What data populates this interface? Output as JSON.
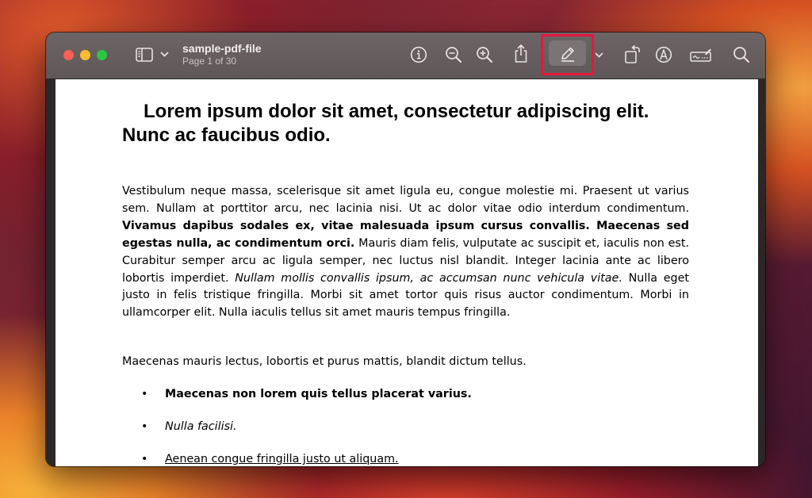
{
  "window": {
    "document_name": "sample-pdf-file",
    "page_indicator": "Page 1 of 30"
  },
  "toolbar": {
    "icons": [
      "sidebar-icon",
      "chevron-down-icon",
      "info-icon",
      "zoom-out-icon",
      "zoom-in-icon",
      "share-icon",
      "pencil-icon",
      "chevron-down-icon",
      "rotate-icon",
      "markup-icon",
      "signature-icon",
      "search-icon"
    ],
    "highlight_color": "#e5173f"
  },
  "document": {
    "heading": "Lorem ipsum dolor sit amet, consectetur adipiscing elit. Nunc ac faucibus odio.",
    "paragraph1": {
      "run1": "Vestibulum neque massa, scelerisque sit amet ligula eu, congue molestie mi. Praesent ut varius sem. Nullam at porttitor arcu, nec lacinia nisi. Ut ac dolor vitae odio interdum condimentum. ",
      "run2_bold": "Vivamus dapibus sodales ex, vitae malesuada ipsum cursus convallis. Maecenas sed egestas nulla, ac condimentum orci.",
      "run3": " Mauris diam felis, vulputate ac suscipit et, iaculis non est. Curabitur semper arcu ac ligula semper, nec luctus nisl blandit. Integer lacinia ante ac libero lobortis imperdiet. ",
      "run4_italic": "Nullam mollis convallis ipsum, ac accumsan nunc vehicula vitae.",
      "run5": " Nulla eget justo in felis tristique fringilla. Morbi sit amet tortor quis risus auctor condimentum. Morbi in ullamcorper elit. Nulla iaculis tellus sit amet mauris tempus fringilla."
    },
    "paragraph2": "Maecenas mauris lectus, lobortis et purus mattis, blandit dictum tellus.",
    "bullet_char": "•",
    "bullets": [
      "Maecenas non lorem quis tellus placerat varius.",
      "Nulla facilisi.",
      "Aenean congue fringilla justo ut aliquam."
    ]
  }
}
